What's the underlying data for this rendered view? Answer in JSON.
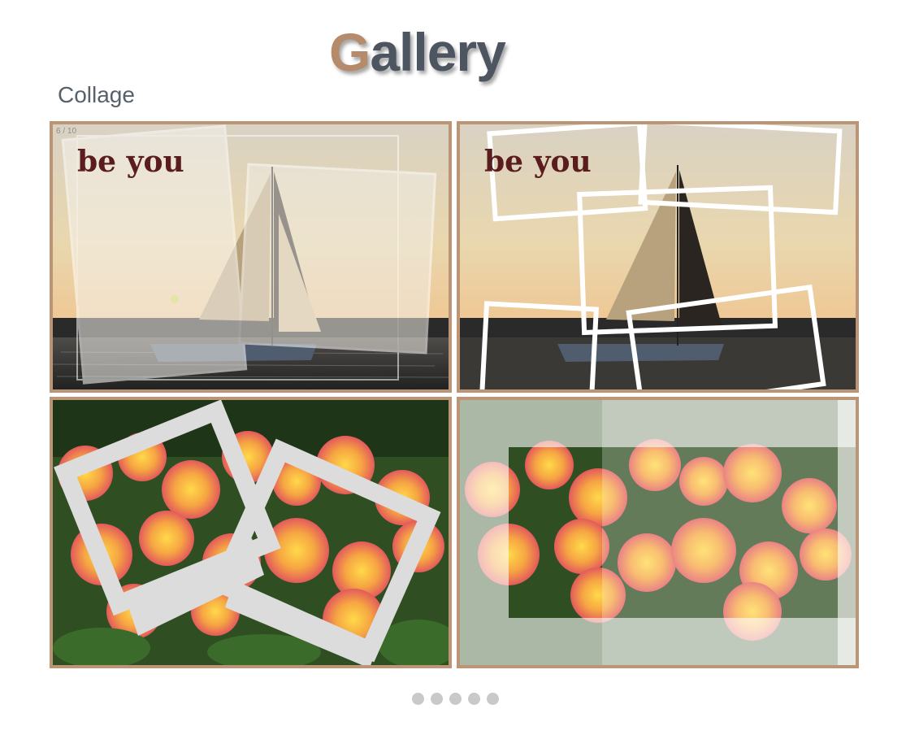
{
  "header": {
    "title_first_letter": "G",
    "title_rest": "allery",
    "subtitle": "Collage"
  },
  "gallery": {
    "counter": "6 / 10",
    "tiles": [
      {
        "name": "sailboat-collage-faded",
        "caption": "be you"
      },
      {
        "name": "sailboat-collage-frames",
        "caption": "be you"
      },
      {
        "name": "flowers-collage-polaroids"
      },
      {
        "name": "flowers-collage-strips"
      }
    ]
  },
  "pagination": {
    "count": 5
  },
  "colors": {
    "frame": "#bb9576",
    "accent": "#b58b6c",
    "title": "#4d5660"
  }
}
